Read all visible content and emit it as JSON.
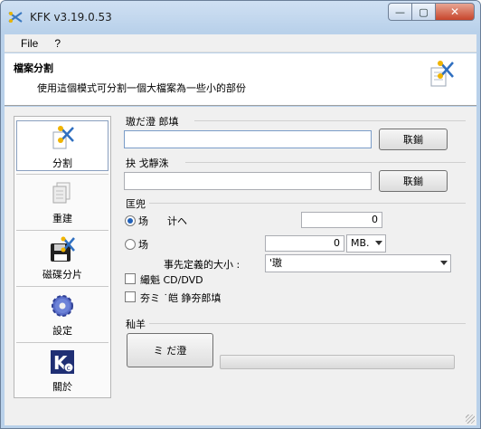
{
  "window": {
    "title": "KFK v3.19.0.53"
  },
  "menu": {
    "items": [
      "File",
      "?"
    ]
  },
  "header": {
    "title": "檔案分割",
    "description": "使用這個模式可分割一個大檔案為一些小的部份"
  },
  "sidebar": {
    "items": [
      {
        "label": "分割",
        "icon": "scissors-icon"
      },
      {
        "label": "重建",
        "icon": "rebuild-icon"
      },
      {
        "label": "磁碟分片",
        "icon": "floppy-icon"
      },
      {
        "label": "設定",
        "icon": "gear-icon"
      },
      {
        "label": "關於",
        "icon": "about-icon"
      }
    ]
  },
  "source": {
    "label": "璈だ澄 郎填",
    "value": "",
    "browse_label": "聅鎆"
  },
  "dest": {
    "label": "抉 戈靜洙",
    "value": "",
    "browse_label": "聅鎆"
  },
  "options": {
    "group_label": "匡兜",
    "by_count": {
      "label": "场",
      "sublabel": "计ヘ",
      "value": "0",
      "selected": true
    },
    "by_size": {
      "label": "场",
      "value": "0",
      "unit": "MB.",
      "selected": false
    },
    "preset_label": "事先定義的大小 :",
    "preset_value": "'璈",
    "cd_label": "繓魁 CD/DVD",
    "delete_label": "夯ミ ˙皑 錚夯郎填"
  },
  "run": {
    "group_label": "秈羊",
    "button_label": "ミ だ澄",
    "progress": 0
  }
}
